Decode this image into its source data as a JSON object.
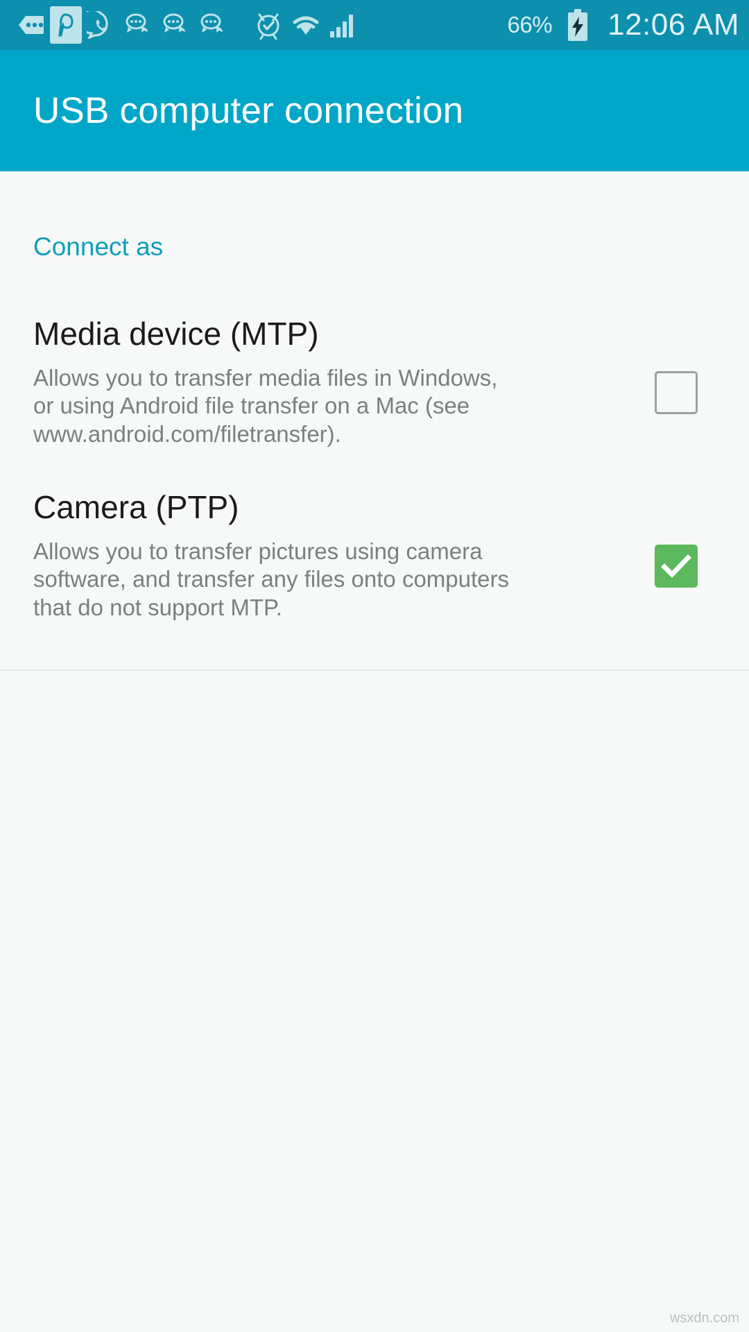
{
  "status_bar": {
    "icons": [
      {
        "name": "messages-more-icon",
        "glyph": "more-bubble"
      },
      {
        "name": "pinterest-icon",
        "glyph": "p-badge"
      },
      {
        "name": "whatsapp-icon",
        "glyph": "whatsapp"
      },
      {
        "name": "message-bubble-icon-1",
        "glyph": "chat"
      },
      {
        "name": "message-bubble-icon-2",
        "glyph": "chat"
      },
      {
        "name": "message-bubble-icon-3",
        "glyph": "chat"
      },
      {
        "name": "alarm-clock-icon",
        "glyph": "alarm"
      },
      {
        "name": "wifi-icon",
        "glyph": "wifi"
      },
      {
        "name": "cellular-signal-icon",
        "glyph": "signal"
      }
    ],
    "battery_percent": "66%",
    "battery_charging": true,
    "time": "12:06 AM",
    "background_color": "#0c90ad"
  },
  "action_bar": {
    "title": "USB computer connection",
    "background_color": "#00a6c7",
    "title_color": "#ffffff"
  },
  "content": {
    "section_header": "Connect as",
    "section_header_color": "#0e9fb8",
    "options": [
      {
        "title": "Media device (MTP)",
        "description": "Allows you to transfer media files in Windows, or using Android file transfer on a Mac (see www.android.com/filetransfer).",
        "checked": false,
        "checkbox_name": "checkbox-media-device-mtp"
      },
      {
        "title": "Camera (PTP)",
        "description": "Allows you to transfer pictures using camera software, and transfer any files onto computers that do not support MTP.",
        "checked": true,
        "checkbox_name": "checkbox-camera-ptp",
        "checked_color": "#5cb85c"
      }
    ]
  },
  "watermark": "wsxdn.com"
}
